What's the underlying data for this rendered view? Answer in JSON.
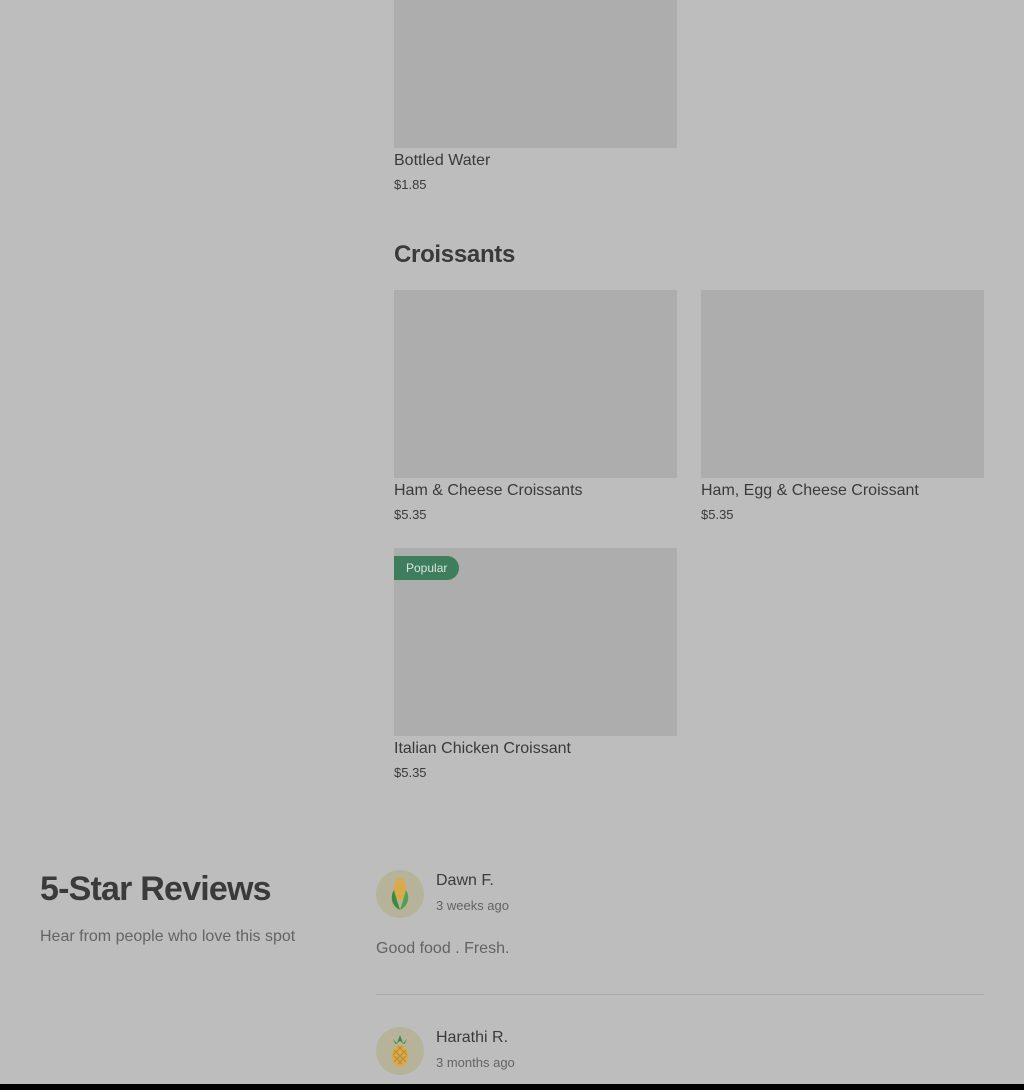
{
  "menu": {
    "drinks_items": [
      {
        "name": "Bottled Water",
        "price": "$1.85"
      }
    ],
    "croissants": {
      "title": "Croissants",
      "items": [
        {
          "name": "Ham & Cheese Croissants",
          "price": "$5.35"
        },
        {
          "name": "Ham, Egg & Cheese Croissant",
          "price": "$5.35"
        },
        {
          "name": "Italian Chicken Croissant",
          "price": "$5.35",
          "badge": "Popular"
        }
      ]
    }
  },
  "reviews": {
    "title": "5-Star Reviews",
    "subtitle": "Hear from people who love this spot",
    "items": [
      {
        "name": "Dawn F.",
        "time": "3 weeks ago",
        "text": "Good food . Fresh.",
        "avatar_icon": "corn-icon"
      },
      {
        "name": "Harathi R.",
        "time": "3 months ago",
        "avatar_icon": "pineapple-icon"
      }
    ]
  },
  "colors": {
    "overlay_background": "#bdbdbd",
    "image_placeholder": "#adadad",
    "badge_background": "#3f7e5c",
    "avatar_background": "#b6b39a"
  }
}
